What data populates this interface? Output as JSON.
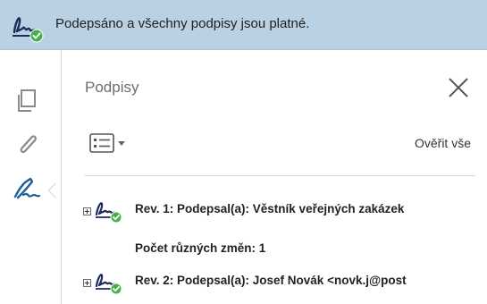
{
  "banner": {
    "text": "Podepsáno a všechny podpisy jsou platné.",
    "icon": "signature-valid-icon"
  },
  "rail": {
    "items": [
      {
        "icon": "pages-icon"
      },
      {
        "icon": "paperclip-icon"
      },
      {
        "icon": "signature-pen-icon",
        "selected": true
      }
    ]
  },
  "panel": {
    "title": "Podpisy",
    "close_icon": "close-icon",
    "options_icon": "options-menu-icon",
    "verify_all": "Ověřit vše",
    "signatures": [
      {
        "expander": "⊞",
        "icon": "signature-valid-icon",
        "label": "Rev. 1: Podepsal(a): Věstník veřejných zakázek"
      },
      {
        "expander": "⊞",
        "icon": "signature-valid-icon",
        "label": "Rev. 2: Podepsal(a): Josef Novák <novk.j@post"
      }
    ],
    "changes_text": "Počet různých změn: 1"
  },
  "colors": {
    "banner_bg": "#bad1e3",
    "valid_green": "#44b049",
    "signature_ink": "#1c2a5c",
    "rail_active": "#1f5e9c"
  }
}
